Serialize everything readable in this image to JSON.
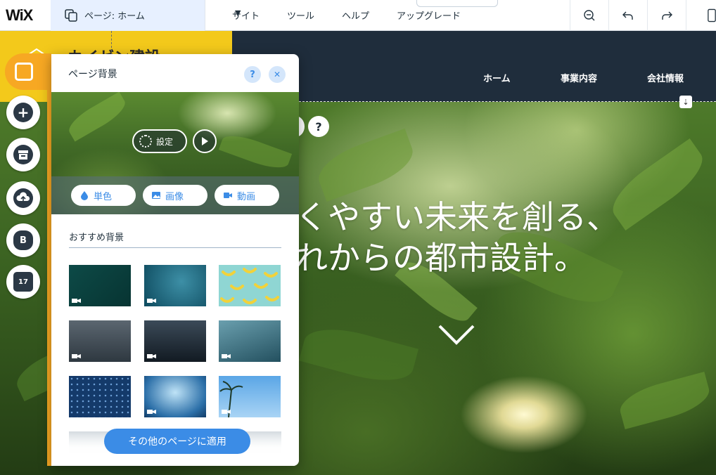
{
  "topbar": {
    "logo": "WiX",
    "page_selector": "ページ: ホーム",
    "menu": [
      "サイト",
      "ツール",
      "ヘルプ",
      "アップグレード"
    ],
    "pull_tab": "^"
  },
  "site": {
    "nav": [
      "ホーム",
      "事業内容",
      "会社情報"
    ],
    "brand": "カイゼン建設",
    "headline_line1": "くやすい未来を創る、",
    "headline_line2": "れからの都市設計。",
    "help": "?"
  },
  "left_toolbar": {
    "blog_letter": "B",
    "calendar_day": "17"
  },
  "panel": {
    "title": "ページ背景",
    "help": "?",
    "close": "✕",
    "settings_label": "設定",
    "types": [
      "単色",
      "画像",
      "動画"
    ],
    "section_title": "おすすめ背景",
    "apply_label": "その他のページに適用"
  },
  "colors": {
    "accent": "#3b8ce6",
    "orange": "#f7a823",
    "header_dark": "#1f2d3c",
    "brand_yellow": "#f3c91b"
  }
}
